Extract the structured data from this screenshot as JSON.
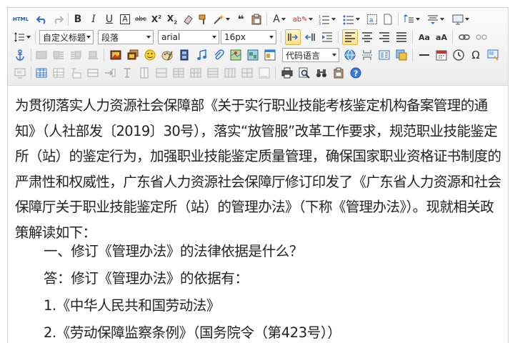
{
  "toolbar": {
    "html_label": "HTML",
    "heading_style": "自定义标题",
    "paragraph_format": "段落",
    "font_family": "arial",
    "font_size": "16px",
    "code_language": "代码语言",
    "accent_color": "#3a7bd5"
  },
  "content": {
    "paragraph_1": "为贯彻落实人力资源社会保障部《关于实行职业技能考核鉴定机构备案管理的通知》（人社部发〔2019〕30号），落实“放管服”改革工作要求，规范职业技能鉴定所（站）的鉴定行为，加强职业技能鉴定质量管理，确保国家职业资格证书制度的严肃性和权威性，广东省人力资源社会保障厅修订印发了《广东省人力资源和社会保障厅关于职业技能鉴定所（站）的管理办法》（下称《管理办法》）。现就相关政策解读如下：",
    "question_1": "一、修订《管理办法》的法律依据是什么？",
    "answer_1": "答：修订《管理办法》的依据有：",
    "item_1": "1.《中华人民共和国劳动法》",
    "item_2": "2.《劳动保障监察条例》（国务院令（第423号））"
  }
}
